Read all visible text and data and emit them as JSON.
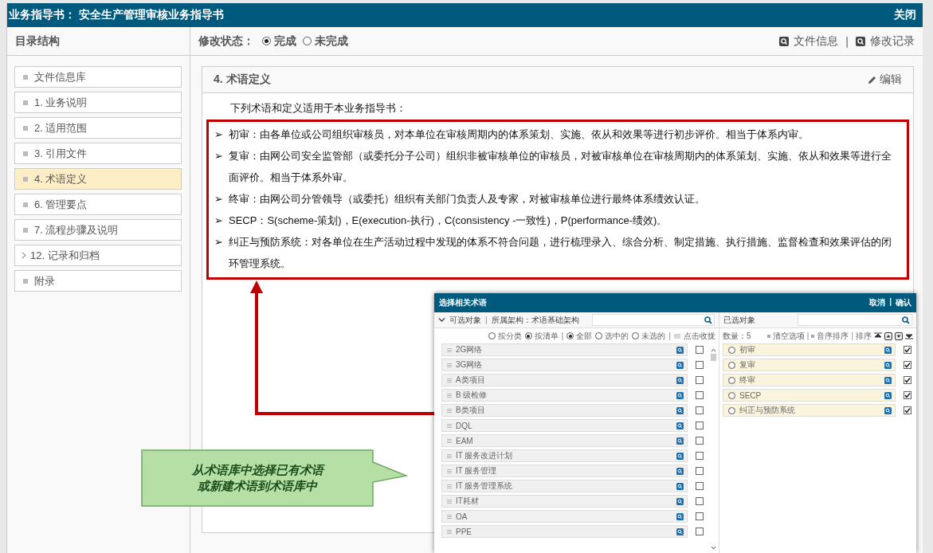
{
  "window": {
    "title": "业务指导书： 安全生产管理审核业务指导书",
    "close": "关闭"
  },
  "sidebar": {
    "title": "目录结构",
    "items": [
      {
        "label": "文件信息库",
        "kind": "leaf",
        "selected": false
      },
      {
        "label": "1. 业务说明",
        "kind": "leaf",
        "selected": false
      },
      {
        "label": "2. 适用范围",
        "kind": "leaf",
        "selected": false
      },
      {
        "label": "3. 引用文件",
        "kind": "leaf",
        "selected": false
      },
      {
        "label": "4. 术语定义",
        "kind": "leaf",
        "selected": true
      },
      {
        "label": "6. 管理要点",
        "kind": "leaf",
        "selected": false
      },
      {
        "label": "7. 流程步骤及说明",
        "kind": "leaf",
        "selected": false
      },
      {
        "label": "12. 记录和归档",
        "kind": "branch",
        "selected": false
      },
      {
        "label": "附录",
        "kind": "leaf",
        "selected": false
      }
    ]
  },
  "status": {
    "label": "修改状态：",
    "options": [
      {
        "label": "完成",
        "selected": true
      },
      {
        "label": "未完成",
        "selected": false
      }
    ]
  },
  "links": {
    "separator": "|",
    "items": [
      "文件信息",
      "修改记录"
    ]
  },
  "section": {
    "title": "4. 术语定义",
    "edit": "编辑",
    "intro": "下列术语和定义适用于本业务指导书：",
    "items": [
      {
        "marker": "➢",
        "text": "初审：由各单位或公司组织审核员，对本单位在审核周期内的体系策划、实施、依从和效果等进行初步评价。相当于体系内审。"
      },
      {
        "marker": "➢",
        "text": "复审：由网公司安全监管部（或委托分子公司）组织非被审核单位的审核员，对被审核单位在审核周期内的体系策划、实施、依从和效果等进行全面评价。相当于体系外审。"
      },
      {
        "marker": "➢",
        "text": "终审：由网公司分管领导（或委托）组织有关部门负责人及专家，对被审核单位进行最终体系绩效认证。"
      },
      {
        "marker": "➢",
        "text": "SECP：S(scheme-策划)，E(execution-执行)，C(consistency -一致性)，P(performance-绩效)。"
      },
      {
        "marker": "➢",
        "text": "纠正与预防系统：对各单位在生产活动过程中发现的体系不符合问题，进行梳理录入、综合分析、制定措施、执行措施、监督检查和效果评估的闭环管理系统。"
      }
    ]
  },
  "callout": {
    "lines": [
      "从术语库中选择已有术语",
      "或新建术语到术语库中"
    ]
  },
  "dialog": {
    "title": "选择相关术语",
    "separator": "|",
    "actions": [
      "取消",
      "确认"
    ],
    "left": {
      "label": "可选对象",
      "scope": "所属架构：术语基础架构",
      "view_options": [
        {
          "label": "按分类",
          "selected": false
        },
        {
          "label": "按清单",
          "selected": true
        }
      ],
      "show_options": [
        {
          "label": "全部",
          "selected": true
        },
        {
          "label": "选中的",
          "selected": false
        },
        {
          "label": "未选的",
          "selected": false
        }
      ],
      "collapse": "点击收拢",
      "terms": [
        {
          "label": "2G网络",
          "checked": false
        },
        {
          "label": "3G网络",
          "checked": false
        },
        {
          "label": "A类项目",
          "checked": false
        },
        {
          "label": "B 级检修",
          "checked": false
        },
        {
          "label": "B类项目",
          "checked": false
        },
        {
          "label": "DQL",
          "checked": false
        },
        {
          "label": "EAM",
          "checked": false
        },
        {
          "label": "IT 服务改进计划",
          "checked": false
        },
        {
          "label": "IT 服务管理",
          "checked": false
        },
        {
          "label": "IT 服务管理系统",
          "checked": false
        },
        {
          "label": "IT耗材",
          "checked": false
        },
        {
          "label": "OA",
          "checked": false
        },
        {
          "label": "PPE",
          "checked": false
        }
      ]
    },
    "right": {
      "label": "已选对象",
      "count": "数量：5",
      "clear": "清空选项",
      "alpha_sort": "音序排序",
      "sort": "排序",
      "terms": [
        {
          "label": "初审",
          "selected": false,
          "checked": true
        },
        {
          "label": "复审",
          "selected": false,
          "checked": true
        },
        {
          "label": "终审",
          "selected": false,
          "checked": true
        },
        {
          "label": "SECP",
          "selected": false,
          "checked": true
        },
        {
          "label": "纠正与预防系统",
          "selected": false,
          "checked": true
        }
      ]
    }
  }
}
